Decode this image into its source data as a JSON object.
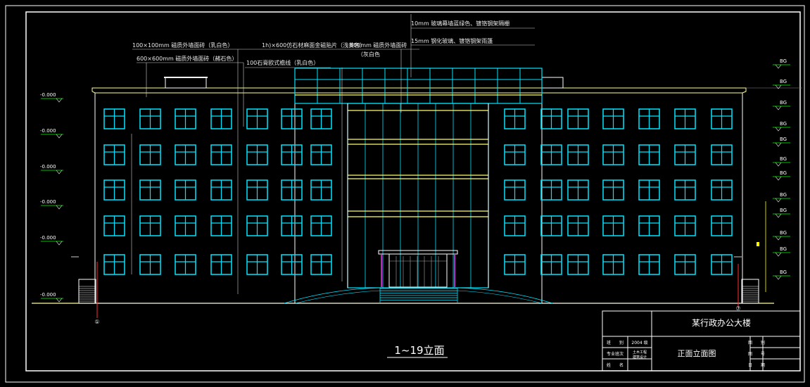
{
  "drawing": {
    "title": "1~19立面",
    "colors": {
      "background": "#000000",
      "frame": "#ffffff",
      "window": "#00e5ff",
      "glass_band": "#ffff66",
      "ground": "#ffff99",
      "grid_axis": "#ff3030",
      "leader": "#d0d0d0",
      "level_mark": "#00ff00",
      "door_accent": "#ff33ff"
    },
    "annotations": [
      {
        "text": "10mm 玻璃幕墙蓝绿色、镀铬钢架隔栅"
      },
      {
        "text": "15mm 钢化玻璃、镀铬钢架雨篷"
      },
      {
        "text": "100×100mm 磁质外墙面砖（乳白色）"
      },
      {
        "text": "1h)×600仿石材麻面金磁贴片（浅黄色）"
      },
      {
        "text": "600mm 磁质外墙面砖"
      },
      {
        "text": "（灰白色"
      },
      {
        "text": "600×600mm 磁质外墙面砖（赭石色）"
      },
      {
        "text": "100石膏欧式檐线（乳白色）"
      }
    ],
    "left_levels": [
      "-0.000",
      "-0.000",
      "-0.000",
      "-0.000",
      "-0.000",
      "-0.000"
    ],
    "right_levels": [
      "BG",
      "BG",
      "BG",
      "BG",
      "BG",
      "BG",
      "BG",
      "BG",
      "BG",
      "BG",
      "BG",
      "BG"
    ],
    "axis_left": "①",
    "axis_right": "⑦"
  },
  "title_block": {
    "project": "某行政办公大楼",
    "drawing_name": "正面立面图",
    "left_rows": [
      {
        "label": "班　　别",
        "value": "2004 级"
      },
      {
        "label": "专业班次",
        "value": "土木工程"
      },
      {
        "label": "姓　　名",
        "value": ""
      }
    ],
    "left_extra": "建筑设计",
    "right_rows": [
      {
        "label": "图　　别",
        "value": ""
      },
      {
        "label": "图　　号",
        "value": ""
      },
      {
        "label": "日　　期",
        "value": ""
      }
    ]
  }
}
